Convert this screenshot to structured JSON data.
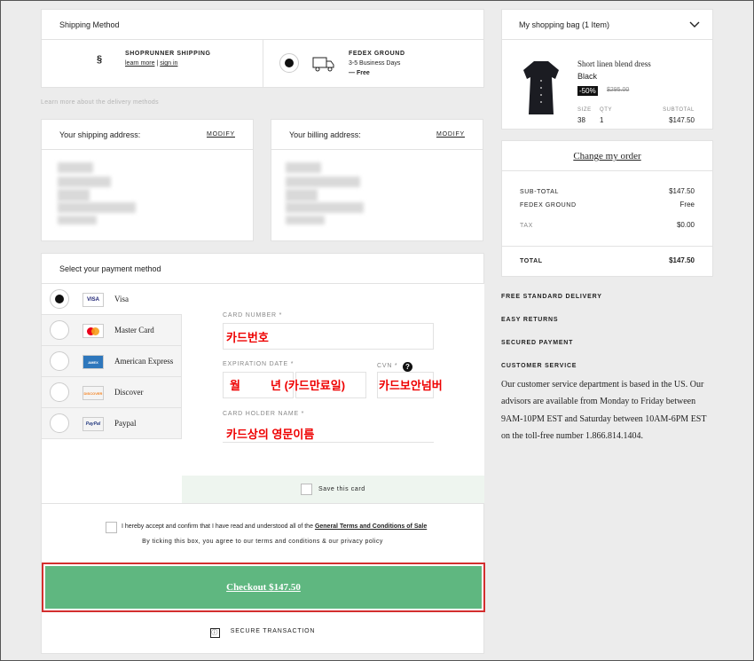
{
  "shipping": {
    "title": "Shipping Method",
    "shoprunner": {
      "name": "SHOPRUNNER SHIPPING",
      "learn_more": "learn more",
      "sep": "|",
      "sign_in": "sign in"
    },
    "fedex": {
      "name": "FEDEX GROUND",
      "days": "3-5 Business Days",
      "price": "— Free"
    },
    "learn_more_delivery": "Learn more about the delivery methods"
  },
  "addresses": {
    "shipping_label": "Your shipping address:",
    "billing_label": "Your billing address:",
    "modify": "MODIFY"
  },
  "payment": {
    "title": "Select your payment method",
    "methods": [
      {
        "name": "Visa",
        "logo": "VISA"
      },
      {
        "name": "Master Card",
        "logo": "MC"
      },
      {
        "name": "American Express",
        "logo": "AMEX"
      },
      {
        "name": "Discover",
        "logo": "DISCOVER"
      },
      {
        "name": "Paypal",
        "logo": "PayPal"
      }
    ],
    "card_number_label": "CARD NUMBER *",
    "card_number_note": "카드번호",
    "expiration_label": "EXPIRATION DATE *",
    "month_note": "월",
    "year_note": "년 (카드만료일)",
    "cvn_label": "CVN *",
    "cvn_help": "?",
    "cvn_note": "카드보안넘버",
    "holder_label": "CARD HOLDER NAME *",
    "holder_note": "카드상의 영문이름",
    "save_card": "Save this card"
  },
  "terms": {
    "text": "I hereby accept and confirm that I have read and understood all of the",
    "link": "General Terms and Conditions of Sale",
    "sub": "By ticking this box, you agree to our terms and conditions & our privacy policy",
    "checkout": "Checkout $147.50",
    "secure": "SECURE TRANSACTION"
  },
  "bag": {
    "title": "My shopping bag (1 Item)",
    "product": {
      "name": "Short linen blend dress",
      "color": "Black",
      "discount": "-50%",
      "old_price": "$295.00",
      "size_label": "SIZE",
      "size": "38",
      "qty_label": "QTY",
      "qty": "1",
      "subtotal_label": "SUBTOTAL",
      "subtotal": "$147.50"
    }
  },
  "order": {
    "change": "Change my order",
    "subtotal_label": "SUB-TOTAL",
    "subtotal": "$147.50",
    "shipping_label": "FEDEX GROUND",
    "shipping": "Free",
    "tax_label": "TAX",
    "tax": "$0.00",
    "total_label": "TOTAL",
    "total": "$147.50"
  },
  "perks": [
    "FREE STANDARD DELIVERY",
    "EASY RETURNS",
    "SECURED PAYMENT",
    "CUSTOMER SERVICE"
  ],
  "customer_service": "Our customer service department is based in the US. Our advisors are available from Monday to Friday between 9AM-10PM EST and Saturday between 10AM-6PM EST on the toll-free number 1.866.814.1404.",
  "colors": {
    "accent_green": "#5fb780",
    "highlight_red": "#d32f2f",
    "save_bar": "#eef5ef"
  }
}
